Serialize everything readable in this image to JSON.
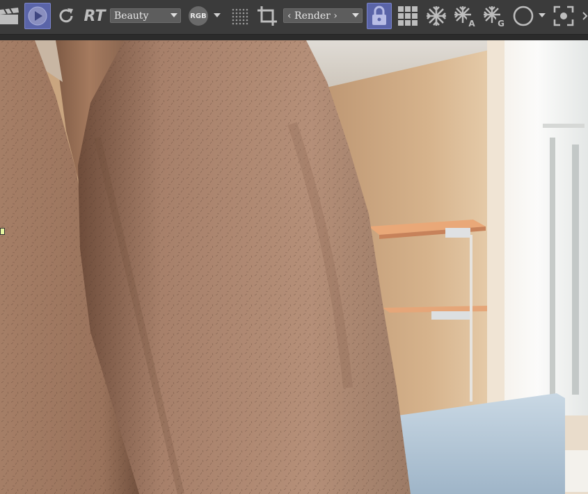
{
  "toolbar": {
    "icons": [
      "clapperboard-icon",
      "play-icon",
      "refresh-icon",
      "crop-icon",
      "lock-icon",
      "grid-icon",
      "snowflake-icon",
      "snowflake-a-icon",
      "snowflake-g-icon",
      "circle-icon",
      "focus-icon"
    ],
    "rt_label": "RT",
    "pass_dropdown": {
      "value": "Beauty"
    },
    "rgb_label": "RGB",
    "render_dropdown": {
      "value": "‹ Render ›"
    },
    "snow_a_label": "A",
    "snow_g_label": "G",
    "accent_color": "#5a64a8"
  },
  "viewport": {
    "description_colors": {
      "wall": "#d2ae86",
      "skin": "#b98c6c",
      "window": "#eef0ee",
      "seat": "#aec3d6"
    }
  }
}
